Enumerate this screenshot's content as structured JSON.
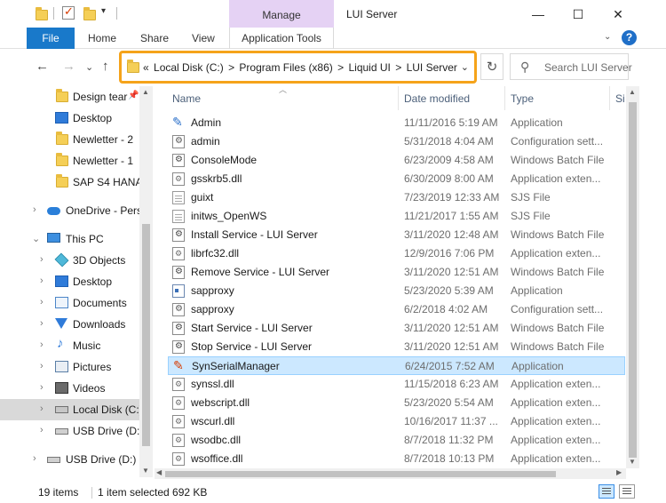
{
  "titlebar": {
    "context_tab": "Manage",
    "title": "LUI Server",
    "quick_access_arrow": "▾",
    "minimize": "—",
    "maximize": "☐",
    "close": "✕"
  },
  "ribbon": {
    "file": "File",
    "tabs": [
      "Home",
      "Share",
      "View"
    ],
    "app_tools": "Application Tools",
    "help": "?",
    "collapse": "⌄"
  },
  "nav_buttons": {
    "back": "←",
    "forward": "→",
    "recent": "⌄",
    "up": "↑"
  },
  "address": {
    "overflow": "«",
    "segments": [
      "Local Disk (C:)",
      "Program Files (x86)",
      "Liquid UI",
      "LUI Server"
    ],
    "separator": ">",
    "dropdown": "⌄"
  },
  "refresh": "↻",
  "search": {
    "placeholder": "Search LUI Server"
  },
  "nav_pane": {
    "quick_access": [
      "Design tear",
      "Desktop",
      "Newletter - 2",
      "Newletter - 1",
      "SAP S4 HANA"
    ],
    "onedrive": "OneDrive - Pers",
    "this_pc": "This PC",
    "pc_items": [
      "3D Objects",
      "Desktop",
      "Documents",
      "Downloads",
      "Music",
      "Pictures",
      "Videos",
      "Local Disk (C:)",
      "USB Drive (D:)"
    ],
    "usb_drive": "USB Drive (D:)",
    "expand": "›",
    "expanded": "⌄",
    "pin": "📌"
  },
  "columns": {
    "name": "Name",
    "date": "Date modified",
    "type": "Type",
    "size": "Si"
  },
  "files": [
    {
      "name": "Admin",
      "date": "11/11/2016 5:19 AM",
      "type": "Application",
      "icon": "admin-icon"
    },
    {
      "name": "admin",
      "date": "5/31/2018 4:04 AM",
      "type": "Configuration sett...",
      "icon": "config-icon"
    },
    {
      "name": "ConsoleMode",
      "date": "6/23/2009 4:58 AM",
      "type": "Windows Batch File",
      "icon": "batch-icon"
    },
    {
      "name": "gsskrb5.dll",
      "date": "6/30/2009 8:00 AM",
      "type": "Application exten...",
      "icon": "dll-icon"
    },
    {
      "name": "guixt",
      "date": "7/23/2019 12:33 AM",
      "type": "SJS File",
      "icon": "sjs-icon"
    },
    {
      "name": "initws_OpenWS",
      "date": "11/21/2017 1:55 AM",
      "type": "SJS File",
      "icon": "sjs-icon"
    },
    {
      "name": "Install Service - LUI Server",
      "date": "3/11/2020 12:48 AM",
      "type": "Windows Batch File",
      "icon": "batch-icon"
    },
    {
      "name": "librfc32.dll",
      "date": "12/9/2016 7:06 PM",
      "type": "Application exten...",
      "icon": "dll-icon"
    },
    {
      "name": "Remove Service - LUI Server",
      "date": "3/11/2020 12:51 AM",
      "type": "Windows Batch File",
      "icon": "batch-icon"
    },
    {
      "name": "sapproxy",
      "date": "5/23/2020 5:39 AM",
      "type": "Application",
      "icon": "proxy-app-icon"
    },
    {
      "name": "sapproxy",
      "date": "6/2/2018 4:02 AM",
      "type": "Configuration sett...",
      "icon": "config-icon"
    },
    {
      "name": "Start Service - LUI Server",
      "date": "3/11/2020 12:51 AM",
      "type": "Windows Batch File",
      "icon": "batch-icon"
    },
    {
      "name": "Stop Service - LUI Server",
      "date": "3/11/2020 12:51 AM",
      "type": "Windows Batch File",
      "icon": "batch-icon"
    },
    {
      "name": "SynSerialManager",
      "date": "6/24/2015 7:52 AM",
      "type": "Application",
      "icon": "syn-icon"
    },
    {
      "name": "synssl.dll",
      "date": "11/15/2018 6:23 AM",
      "type": "Application exten...",
      "icon": "dll-icon"
    },
    {
      "name": "webscript.dll",
      "date": "5/23/2020 5:54 AM",
      "type": "Application exten...",
      "icon": "dll-icon"
    },
    {
      "name": "wscurl.dll",
      "date": "10/16/2017 11:37 ...",
      "type": "Application exten...",
      "icon": "dll-icon"
    },
    {
      "name": "wsodbc.dll",
      "date": "8/7/2018 11:32 PM",
      "type": "Application exten...",
      "icon": "dll-icon"
    },
    {
      "name": "wsoffice.dll",
      "date": "8/7/2018 10:13 PM",
      "type": "Application exten...",
      "icon": "dll-icon"
    }
  ],
  "selected_file": "SynSerialManager",
  "status": {
    "items": "19 items",
    "selection": "1 item selected  692 KB"
  },
  "colors": {
    "accent": "#1979ca",
    "highlight": "#f5a31a",
    "selection": "#cce8ff",
    "manage_tab": "#e5d2f4"
  }
}
